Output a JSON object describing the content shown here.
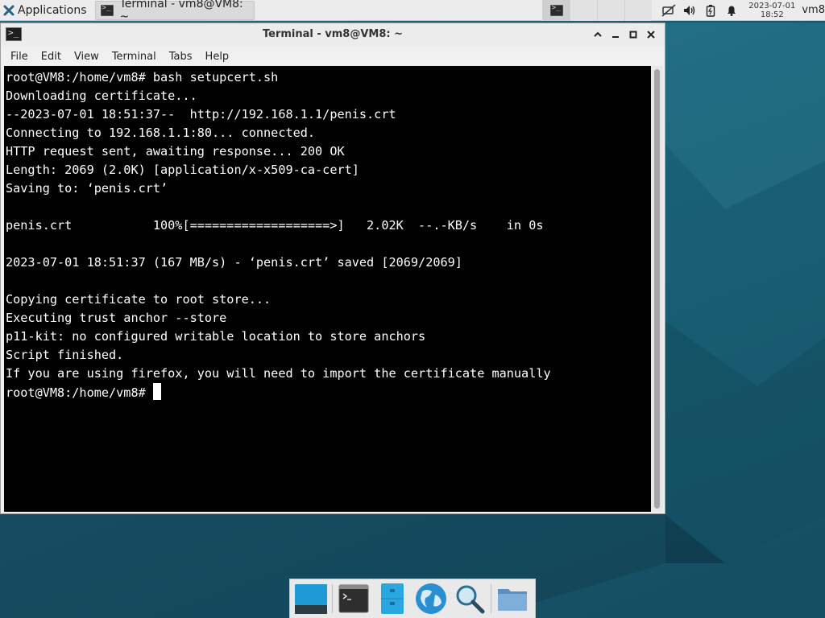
{
  "top_panel": {
    "applications_label": "Applications",
    "task_label": "Terminal - vm8@VM8: ~",
    "clock": {
      "date": "2023-07-01",
      "time": "18:52"
    },
    "user": "vm8"
  },
  "window": {
    "title": "Terminal - vm8@VM8: ~",
    "controls": {
      "shade": "^",
      "minimize": "_",
      "maximize": "□",
      "close": "✕"
    }
  },
  "menubar": {
    "items": [
      "File",
      "Edit",
      "View",
      "Terminal",
      "Tabs",
      "Help"
    ]
  },
  "terminal": {
    "lines": [
      "root@VM8:/home/vm8# bash setupcert.sh",
      "Downloading certificate...",
      "--2023-07-01 18:51:37--  http://192.168.1.1/penis.crt",
      "Connecting to 192.168.1.1:80... connected.",
      "HTTP request sent, awaiting response... 200 OK",
      "Length: 2069 (2.0K) [application/x-x509-ca-cert]",
      "Saving to: ‘penis.crt’",
      "",
      "penis.crt           100%[===================>]   2.02K  --.-KB/s    in 0s",
      "",
      "2023-07-01 18:51:37 (167 MB/s) - ‘penis.crt’ saved [2069/2069]",
      "",
      "Copying certificate to root store...",
      "Executing trust anchor --store",
      "p11-kit: no configured writable location to store anchors",
      "Script finished.",
      "If you are using firefox, you will need to import the certificate manually"
    ],
    "prompt": "root@VM8:/home/vm8# "
  },
  "dock": {
    "items": [
      "desktop-icon",
      "terminal-icon",
      "file-manager-icon",
      "web-browser-icon",
      "app-finder-icon",
      "home-folder-icon"
    ]
  },
  "colors": {
    "terminal_bg": "#000000",
    "terminal_fg": "#ffffff",
    "panel_bg": "#ececec",
    "desktop": "#18566c"
  }
}
